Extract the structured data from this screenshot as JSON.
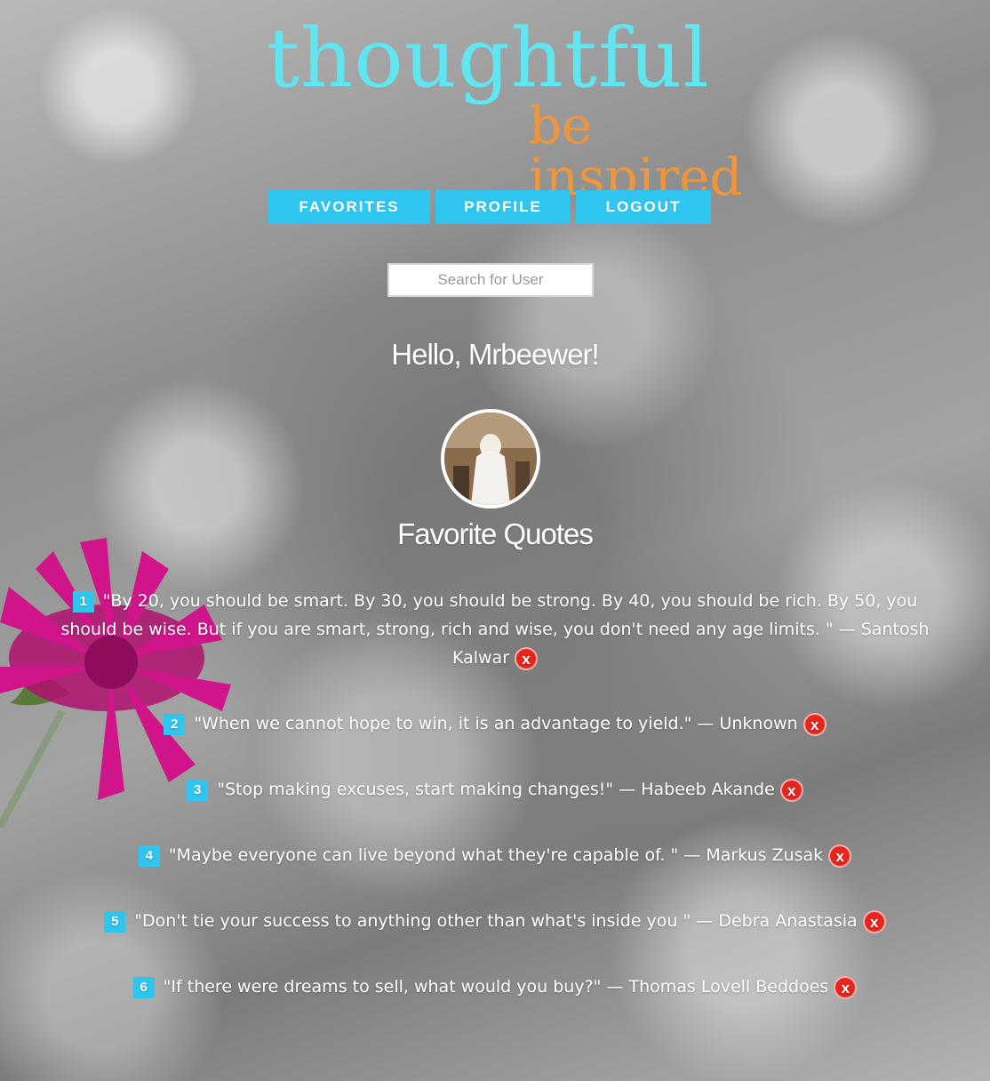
{
  "logo": {
    "title": "thoughtful",
    "tagline": "be inspired"
  },
  "nav": {
    "favorites": "FAVORITES",
    "profile": "PROFILE",
    "logout": "LOGOUT"
  },
  "search": {
    "placeholder": "Search for User",
    "value": ""
  },
  "greeting": "Hello, Mrbeewer!",
  "section_title": "Favorite Quotes",
  "delete_label": "x",
  "colors": {
    "accent": "#2fc5ef",
    "logo_main": "#5fe6f0",
    "logo_sub": "#f0963a",
    "delete": "#e8251c"
  },
  "quotes": [
    {
      "num": "1",
      "text": "\"By 20, you should be smart. By 30, you should be strong. By 40, you should be rich. By 50, you should be wise. But if you are smart, strong, rich and wise, you don't need any age limits. \" — Santosh Kalwar"
    },
    {
      "num": "2",
      "text": "\"When we cannot hope to win, it is an advantage to yield.\" — Unknown"
    },
    {
      "num": "3",
      "text": "\"Stop making excuses, start making changes!\" — Habeeb Akande"
    },
    {
      "num": "4",
      "text": "\"Maybe everyone can live beyond what they're capable of. \" — Markus Zusak"
    },
    {
      "num": "5",
      "text": "\"Don't tie your success to anything other than what's inside you \" — Debra Anastasia"
    },
    {
      "num": "6",
      "text": "\"If there were dreams to sell, what would you buy?\" — Thomas Lovell Beddoes"
    }
  ]
}
